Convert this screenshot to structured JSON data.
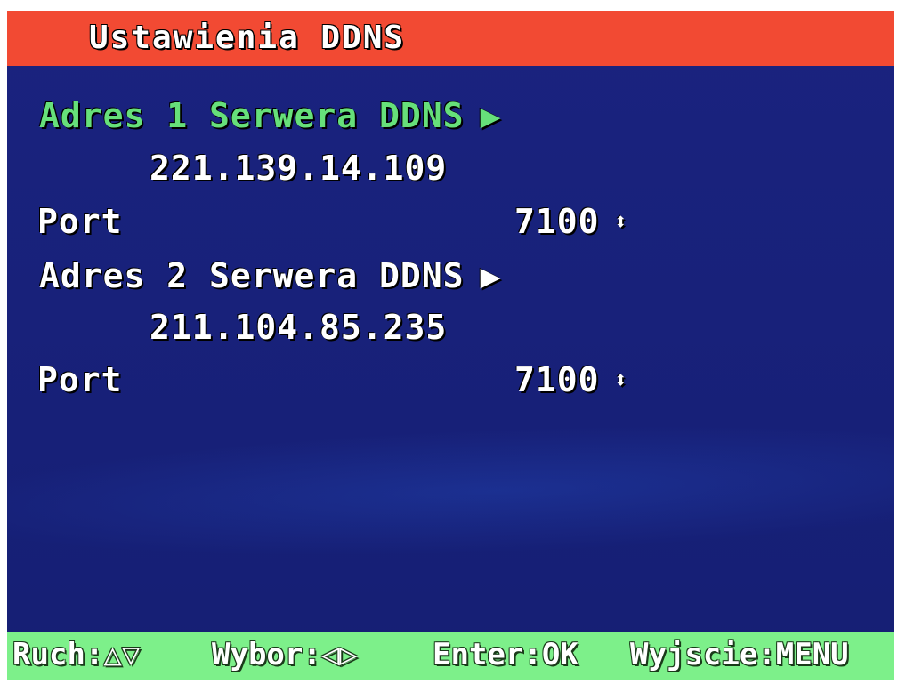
{
  "header": {
    "title": "Ustawienia DDNS"
  },
  "menu": {
    "server1": {
      "label": "Adres 1 Serwera DDNS",
      "arrow": "▶",
      "address": "221.139.14.109"
    },
    "port1": {
      "label": "Port",
      "value": "7100",
      "updown": "⬍"
    },
    "server2": {
      "label": "Adres 2 Serwera DDNS",
      "arrow": "▶",
      "address": "211.104.85.235"
    },
    "port2": {
      "label": "Port",
      "value": "7100",
      "updown": "⬍"
    }
  },
  "footer": {
    "move": "Ruch:△▽",
    "select": "Wybor:◁▷",
    "enter": "Enter:OK",
    "exit": "Wyjscie:MENU"
  },
  "colors": {
    "background": "#1a237f",
    "title_bar": "#f24a33",
    "footer_bar": "#7df08a",
    "selected_text": "#66e07a",
    "text": "#ffffff"
  }
}
